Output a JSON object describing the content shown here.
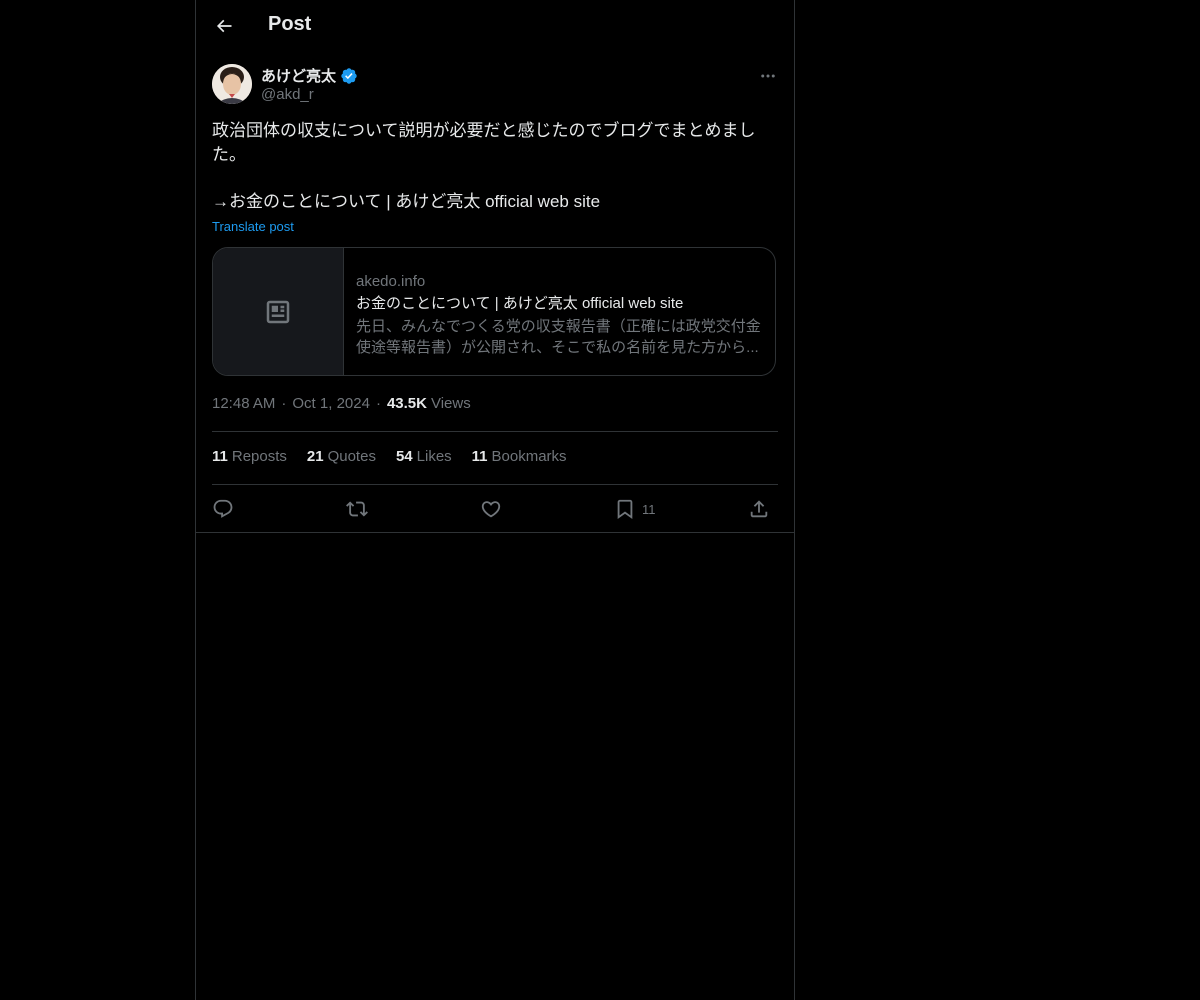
{
  "header": {
    "title": "Post",
    "back_icon": "arrow-left-icon"
  },
  "author": {
    "name": "あけど亮太",
    "handle": "@akd_r",
    "verified": true,
    "verified_color": "#1d9bf0"
  },
  "post": {
    "text_line1": "政治団体の収支について説明が必要だと感じたのでブログでまとめました。",
    "text_line2": "→お金のことについて | あけど亮太 official web site",
    "translate_label": "Translate post"
  },
  "link_card": {
    "domain": "akedo.info",
    "title": "お金のことについて | あけど亮太 official web site",
    "description": "先日、みんなでつくる党の収支報告書（正確には政党交付金使途等報告書）が公開され、そこで私の名前を見た方から...",
    "thumb_icon": "article-icon"
  },
  "meta": {
    "time": "12:48 AM",
    "date": "Oct 1, 2024",
    "views_count": "43.5K",
    "views_label": "Views"
  },
  "stats": {
    "reposts_count": "11",
    "reposts_label": "Reposts",
    "quotes_count": "21",
    "quotes_label": "Quotes",
    "likes_count": "54",
    "likes_label": "Likes",
    "bookmarks_count": "11",
    "bookmarks_label": "Bookmarks"
  },
  "actions": {
    "bookmark_count": "11"
  },
  "colors": {
    "background": "#000000",
    "text_primary": "#e7e9ea",
    "text_secondary": "#71767b",
    "accent": "#1d9bf0",
    "border": "#2f3336"
  }
}
